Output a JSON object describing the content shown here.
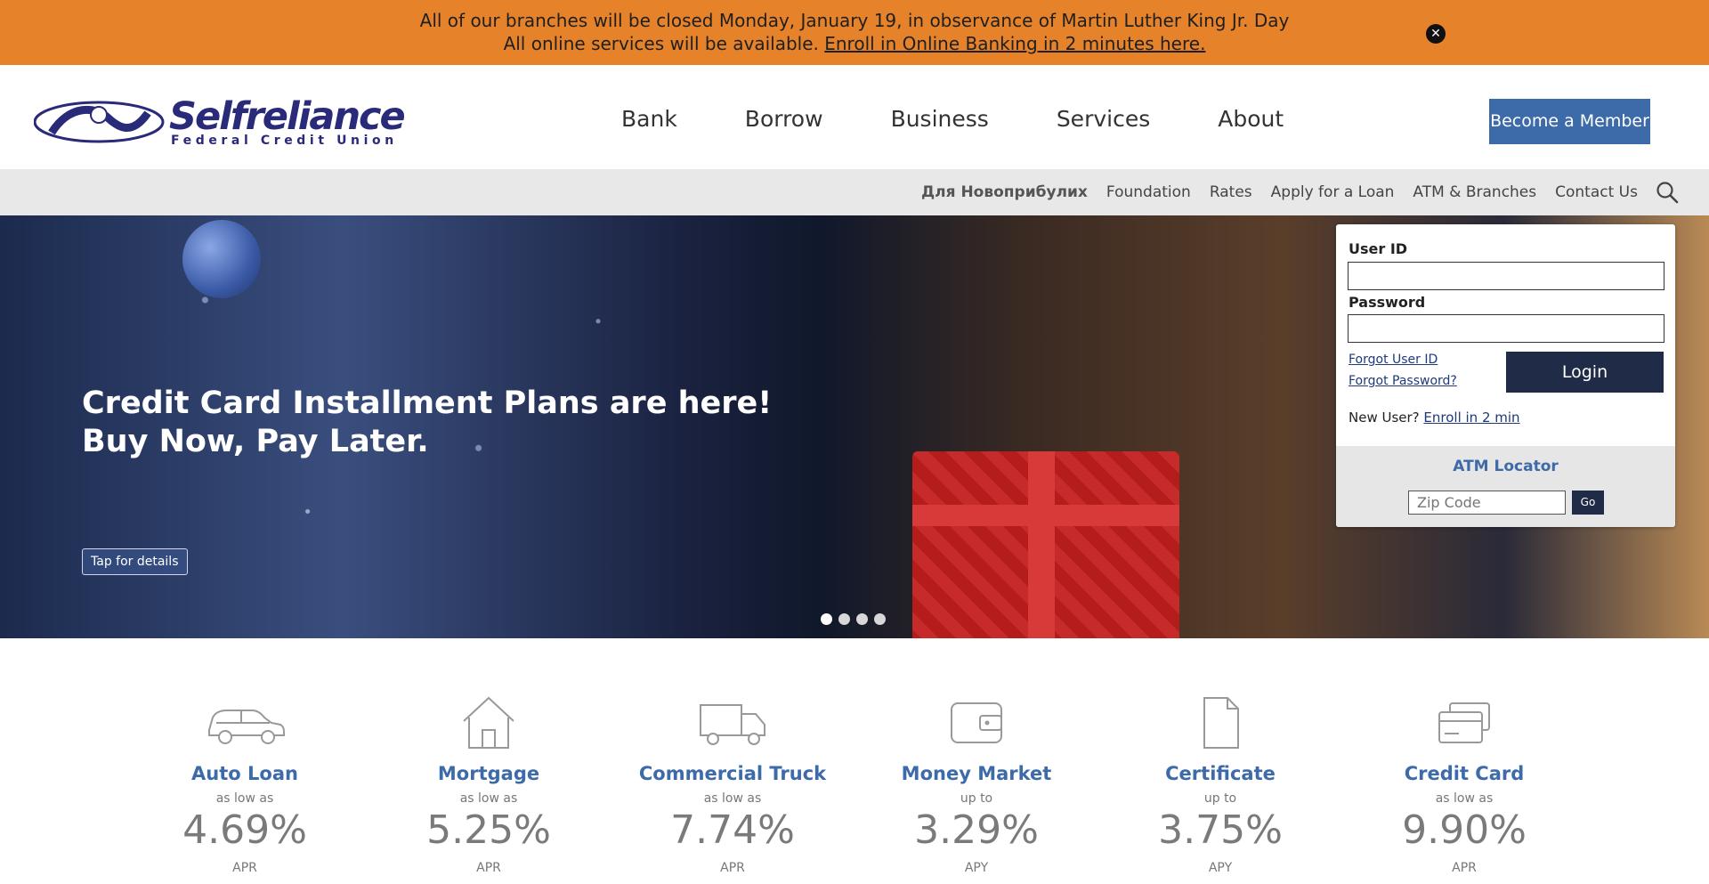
{
  "alert": {
    "line1": "All of our branches will be closed Monday, January 19, in observance of Martin Luther King Jr. Day",
    "line2_prefix": "All online services will be available. ",
    "line2_link": "Enroll in Online Banking in 2 minutes here.",
    "close_icon": "close-icon"
  },
  "header": {
    "logo_brand": "Selfreliance",
    "logo_sub": "Federal Credit Union",
    "nav": [
      "Bank",
      "Borrow",
      "Business",
      "Services",
      "About"
    ],
    "member_button": "Become a Member"
  },
  "subnav": {
    "links": [
      "Для Новоприбулих",
      "Foundation",
      "Rates",
      "Apply for a Loan",
      "ATM & Branches",
      "Contact Us"
    ],
    "search_icon": "search-icon"
  },
  "hero": {
    "headline_line1": "Credit Card Installment Plans are here!",
    "headline_line2": "Buy Now, Pay Later.",
    "details_button": "Tap for details",
    "slide_count": 4,
    "active_slide": 1
  },
  "login": {
    "user_id_label": "User ID",
    "user_id_value": "",
    "password_label": "Password",
    "password_value": "",
    "forgot_user_id": "Forgot User ID",
    "forgot_password": "Forgot Password?",
    "login_button": "Login",
    "new_user_prefix": "New User? ",
    "enroll_link": "Enroll in 2 min",
    "atm_title": "ATM Locator",
    "zip_placeholder": "Zip Code",
    "go_button": "Go"
  },
  "rates": [
    {
      "icon": "car-icon",
      "name": "Auto Loan",
      "qualifier": "as low as",
      "value": "4.69",
      "percent": "%",
      "unit": "APR"
    },
    {
      "icon": "house-icon",
      "name": "Mortgage",
      "qualifier": "as low as",
      "value": "5.25",
      "percent": "%",
      "unit": "APR"
    },
    {
      "icon": "truck-icon",
      "name": "Commercial Truck",
      "qualifier": "as low as",
      "value": "7.74",
      "percent": "%",
      "unit": "APR"
    },
    {
      "icon": "wallet-icon",
      "name": "Money Market",
      "qualifier": "up to",
      "value": "3.29",
      "percent": "%",
      "unit": "APY"
    },
    {
      "icon": "document-icon",
      "name": "Certificate",
      "qualifier": "up to",
      "value": "3.75",
      "percent": "%",
      "unit": "APY"
    },
    {
      "icon": "credit-card-icon",
      "name": "Credit Card",
      "qualifier": "as low as",
      "value": "9.90",
      "percent": "%",
      "unit": "APR"
    }
  ]
}
